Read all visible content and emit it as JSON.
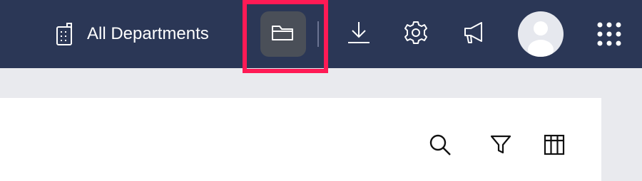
{
  "header": {
    "department_label": "All Departments",
    "icons": {
      "department": "building-icon",
      "folder": "folder-icon",
      "download": "download-icon",
      "settings": "gear-icon",
      "announcement": "megaphone-icon",
      "avatar": "user-avatar",
      "apps": "grid-apps-icon"
    }
  },
  "toolbar": {
    "icons": [
      "search-icon",
      "filter-icon",
      "columns-icon"
    ]
  },
  "colors": {
    "header_bg": "#2b3756",
    "highlight": "#ff1a55",
    "page_bg": "#e9eaee",
    "panel_bg": "#ffffff"
  }
}
